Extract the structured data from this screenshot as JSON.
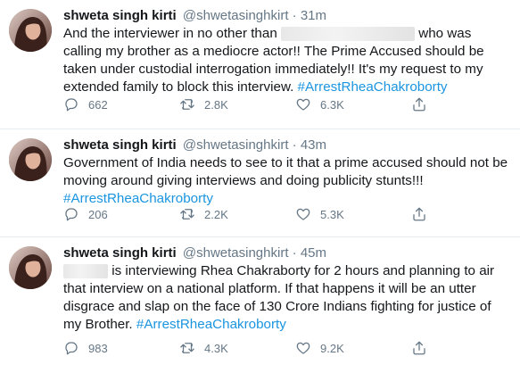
{
  "account": {
    "name": "shweta singh kirti",
    "handle": "@shwetasinghkirt"
  },
  "tweets": [
    {
      "time": "31m",
      "text_parts": [
        "And the interviewer in no other than ",
        " who was calling my brother as a mediocre actor!! The Prime Accused should be taken under custodial  interrogation immediately!! It's my request to my extended family to block this interview. "
      ],
      "hashtag": "#ArrestRheaChakroborty",
      "replies": "662",
      "retweets": "2.8K",
      "likes": "6.3K"
    },
    {
      "time": "43m",
      "text": "Government of India needs to see to it that a prime accused should not be moving around giving interviews and doing publicity stunts!!!",
      "hashtag": "#ArrestRheaChakroborty",
      "replies": "206",
      "retweets": "2.2K",
      "likes": "5.3K"
    },
    {
      "time": "45m",
      "text": " is interviewing Rhea Chakraborty for 2 hours and planning to air that interview on a national platform. If that happens it will be an utter disgrace and slap on the face of 130 Crore Indians fighting for justice of my Brother.",
      "hashtag": "#ArrestRheaChakroborty",
      "replies": "983",
      "retweets": "4.3K",
      "likes": "9.2K"
    }
  ],
  "icons": {
    "reply": "reply-icon",
    "retweet": "retweet-icon",
    "like": "heart-icon",
    "share": "share-icon"
  },
  "colors": {
    "hashtag": "#1b95e0",
    "muted": "#657786",
    "divider": "#e6ecf0"
  }
}
